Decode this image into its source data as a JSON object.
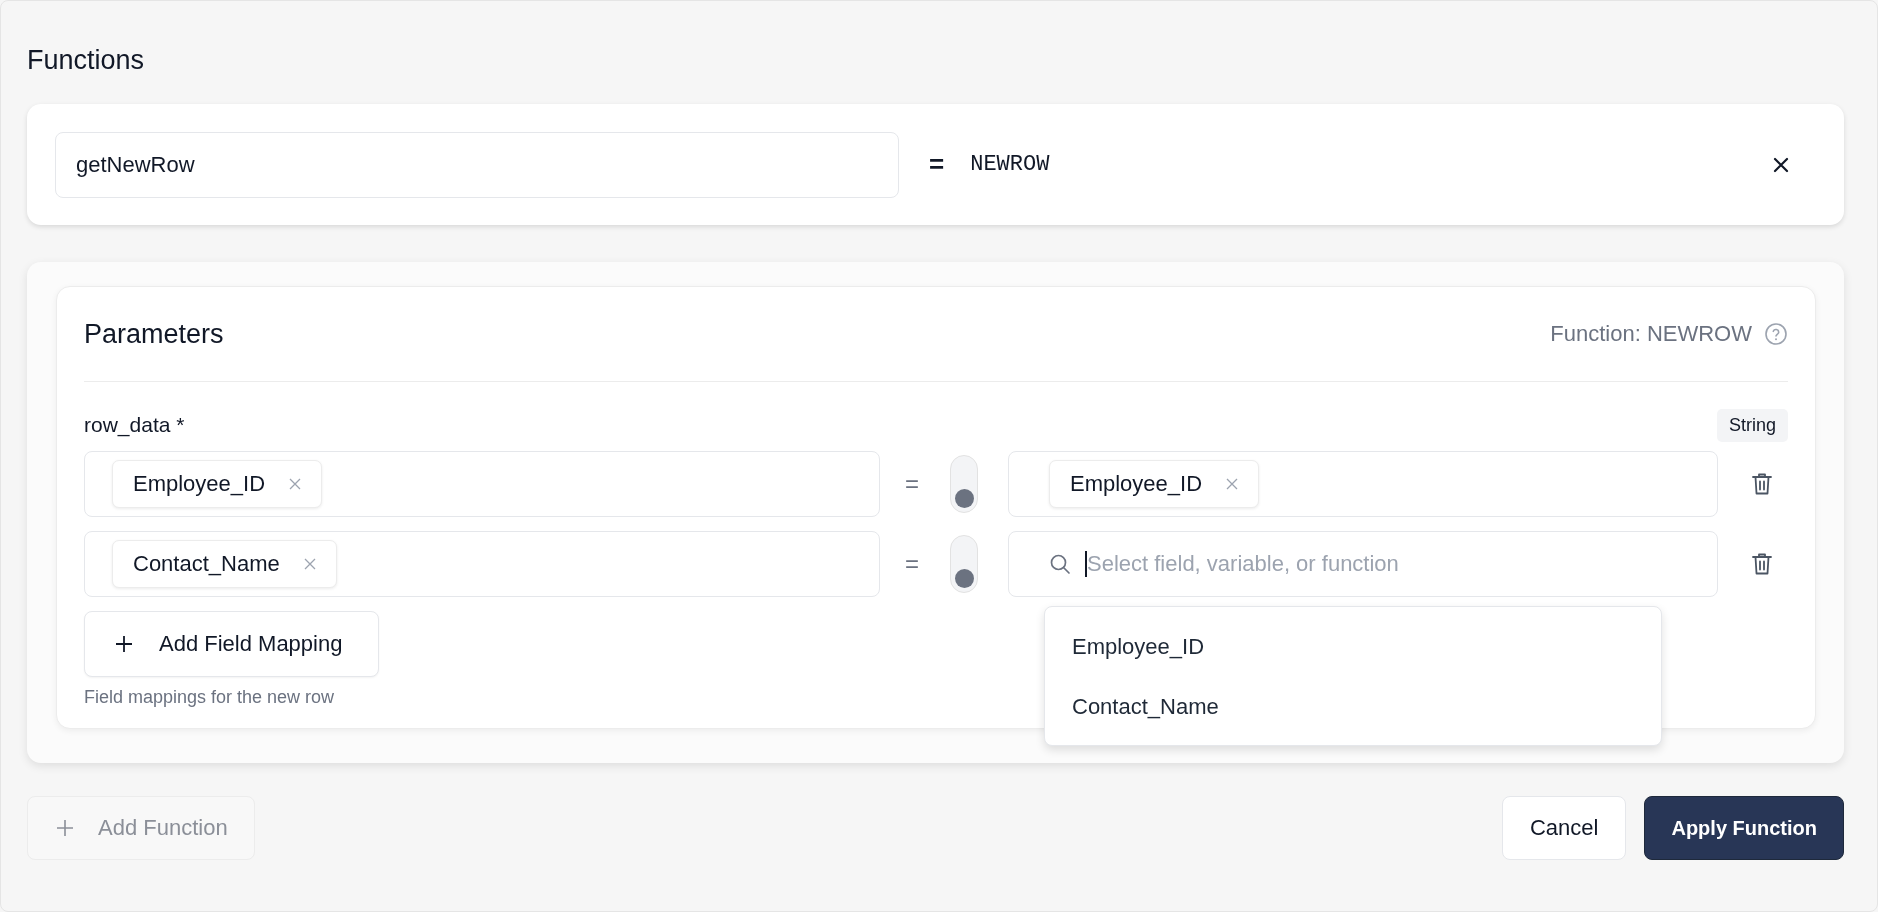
{
  "section_title": "Functions",
  "function": {
    "name": "getNewRow",
    "equals": "=",
    "value": "NEWROW"
  },
  "parameters": {
    "title": "Parameters",
    "function_label": "Function: NEWROW",
    "param": {
      "label": "row_data *",
      "type": "String"
    },
    "mappings": [
      {
        "source_tag": "Employee_ID",
        "equals": "=",
        "toggle_on": false,
        "target": {
          "tag": "Employee_ID",
          "focused": false
        }
      },
      {
        "source_tag": "Contact_Name",
        "equals": "=",
        "toggle_on": false,
        "target": {
          "placeholder": "Select field, variable, or function",
          "focused": true,
          "options": [
            "Employee_ID",
            "Contact_Name"
          ]
        }
      }
    ],
    "add_button": "Add Field Mapping",
    "hint": "Field mappings for the new row"
  },
  "actions": {
    "add_function": {
      "label": "Add Function",
      "disabled": true
    },
    "cancel": "Cancel",
    "apply": "Apply Function"
  }
}
